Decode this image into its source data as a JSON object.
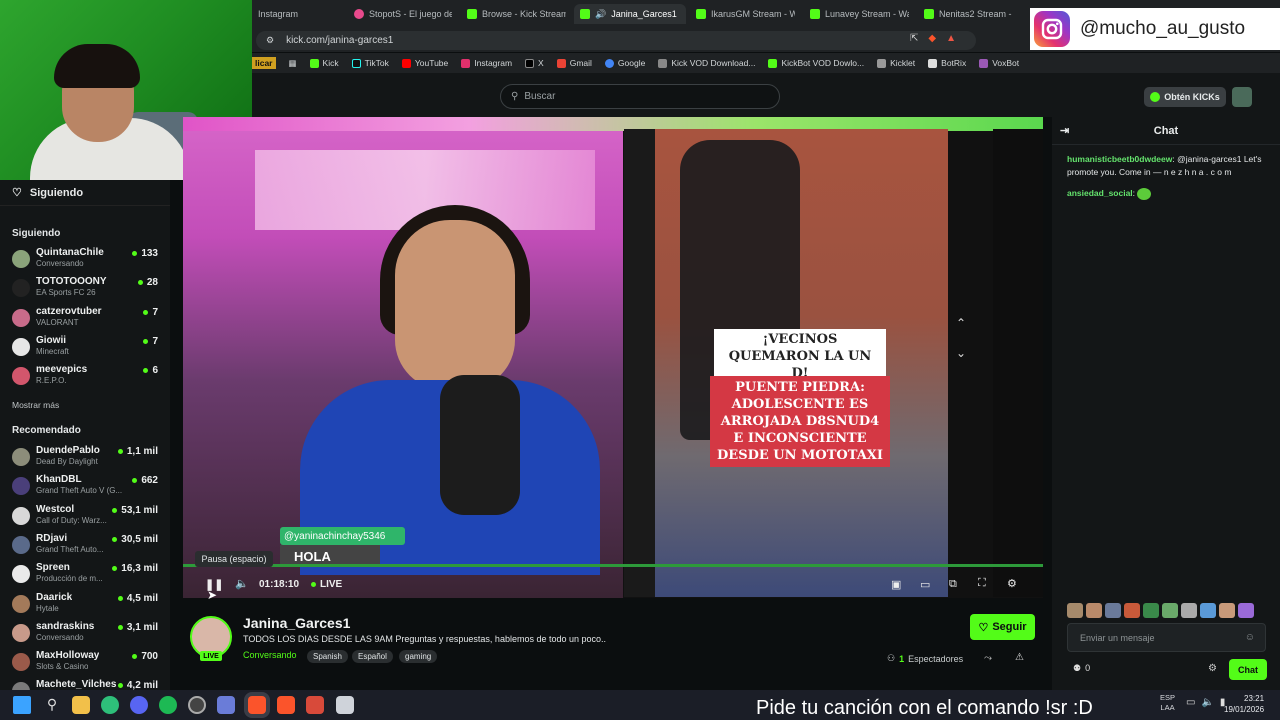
{
  "browser": {
    "tabs": [
      {
        "label": "Instagram",
        "color": "#e1306c"
      },
      {
        "label": "StopotS - El juego de",
        "color": "#e84a8c"
      },
      {
        "label": "Browse - Kick Streamin",
        "color": "#53fc18"
      },
      {
        "label": "Janina_Garces1",
        "color": "#53fc18",
        "active": true
      },
      {
        "label": "IkarusGM Stream - Wa",
        "color": "#53fc18"
      },
      {
        "label": "Lunavey Stream - Wat",
        "color": "#53fc18"
      },
      {
        "label": "Nenitas2 Stream -",
        "color": "#53fc18"
      }
    ],
    "url": "kick.com/janina-garces1",
    "bookmarks": [
      "Kick",
      "TikTok",
      "YouTube",
      "Instagram",
      "X",
      "Gmail",
      "Google",
      "Kick VOD Download...",
      "KickBot VOD Dowlo...",
      "Kicklet",
      "BotRix",
      "VoxBot"
    ],
    "bookmark_prefix": "licar"
  },
  "overlay": {
    "instagram_handle": "@mucho_au_gusto",
    "ticker": "Pide tu canción con el comando !sr :D"
  },
  "header": {
    "search_placeholder": "Buscar",
    "get_kicks": "Obtén KICKs"
  },
  "sidebar": {
    "following_header": "Siguiendo",
    "following_title": "Siguiendo",
    "following": [
      {
        "name": "QuintanaChile",
        "game": "Conversando",
        "viewers": "133",
        "color": "#8aa37a"
      },
      {
        "name": "TOTOTOOONY",
        "game": "EA Sports FC 26",
        "viewers": "28",
        "color": "#222"
      },
      {
        "name": "catzerovtuber",
        "game": "VALORANT",
        "viewers": "7",
        "color": "#c86b8a"
      },
      {
        "name": "Giowii",
        "game": "Minecraft",
        "viewers": "7",
        "color": "#e6e6e6"
      },
      {
        "name": "meevepics",
        "game": "R.E.P.O.",
        "viewers": "6",
        "color": "#d2566c"
      }
    ],
    "show_more": "Mostrar más",
    "recommended_title": "Recomendado",
    "recommended": [
      {
        "name": "DuendePablo",
        "game": "Dead By Daylight",
        "viewers": "1,1 mil",
        "color": "#8c8d7a"
      },
      {
        "name": "KhanDBL",
        "game": "Grand Theft Auto V (G...",
        "viewers": "662",
        "color": "#4a3f7a"
      },
      {
        "name": "Westcol",
        "game": "Call of Duty: Warz...",
        "viewers": "53,1 mil",
        "color": "#d8d8d8"
      },
      {
        "name": "RDjavi",
        "game": "Grand Theft Auto...",
        "viewers": "30,5 mil",
        "color": "#5a6a8a"
      },
      {
        "name": "Spreen",
        "game": "Producción de m...",
        "viewers": "16,3 mil",
        "color": "#eaeaea"
      },
      {
        "name": "Daarick",
        "game": "Hytale",
        "viewers": "4,5 mil",
        "color": "#a37a5a"
      },
      {
        "name": "sandraskins",
        "game": "Conversando",
        "viewers": "3,1 mil",
        "color": "#c89a8a"
      },
      {
        "name": "MaxHolloway",
        "game": "Slots & Casino",
        "viewers": "700",
        "color": "#9a5a4a"
      },
      {
        "name": "Machete_Vilches",
        "game": "",
        "viewers": "4,2 mil",
        "color": "#7a7a7a"
      }
    ]
  },
  "player": {
    "tooltip": "Pausa (espacio)",
    "time": "01:18:10",
    "live": "LIVE",
    "overlay_user": "@yaninachinchay5346",
    "overlay_text": "HOLA",
    "caption_top": "¡VECINOS QUEMARON LA UN   D!",
    "caption_bottom": "PUENTE PIEDRA: ADOLESCENTE ES ARROJADA D8SNUD4 E INCONSCIENTE DESDE UN MOTOTAXI"
  },
  "stream": {
    "name": "Janina_Garces1",
    "live_badge": "LIVE",
    "title": "TODOS LOS DIAS DESDE LAS 9AM Preguntas y respuestas, hablemos de todo un poco..",
    "category": "Conversando",
    "tags": [
      "Spanish",
      "Español",
      "gaming"
    ],
    "follow": "Seguir",
    "viewers_count": "1",
    "viewers_label": "Espectadores"
  },
  "chat": {
    "title": "Chat",
    "messages": [
      {
        "user": "humanisticbeetb0dwdeew",
        "text": "@janina-garces1 Let's promote you. Come in — n e z h n a . c o m"
      },
      {
        "user": "ansiedad_social",
        "text": ""
      }
    ],
    "input_placeholder": "Enviar un mensaje",
    "kicks_count": "0",
    "send": "Chat"
  },
  "taskbar": {
    "lang": "ESP",
    "lang2": "LAA",
    "time": "23:21",
    "date": "19/01/2026"
  }
}
